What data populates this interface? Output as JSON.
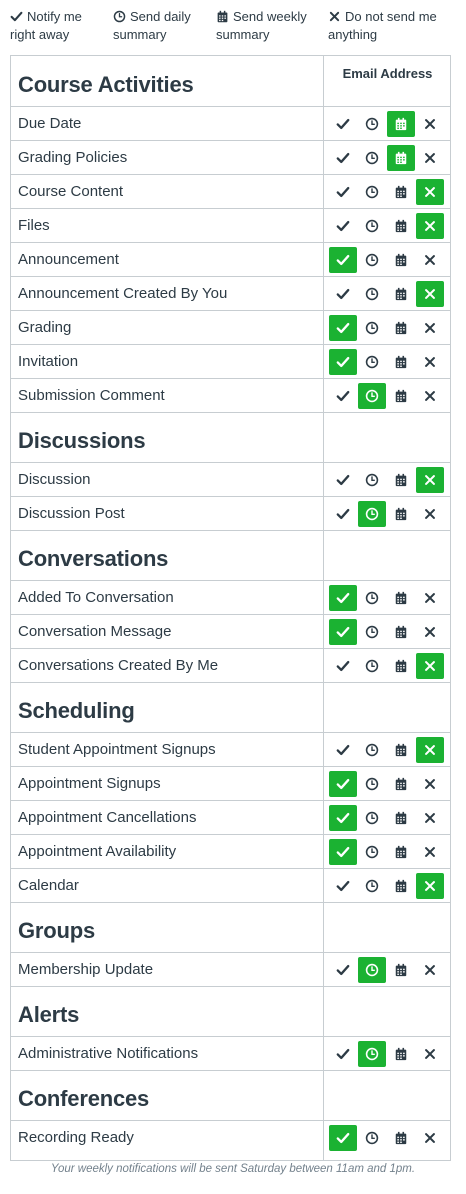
{
  "legend": [
    {
      "icon": "check-icon",
      "label": "Notify me\nright away"
    },
    {
      "icon": "clock-icon",
      "label": "Send daily\nsummary"
    },
    {
      "icon": "calendar-icon",
      "label": "Send weekly\nsummary"
    },
    {
      "icon": "x-icon",
      "label": "Do not send me\nanything"
    }
  ],
  "table": {
    "channel_header": "Email Address"
  },
  "colors": {
    "selected": "#1bb232",
    "icon": "#2d3b45",
    "border": "#c7cdd1"
  },
  "categories": [
    {
      "title": "Course Activities",
      "items": [
        {
          "label": "Due Date",
          "selected": "weekly"
        },
        {
          "label": "Grading Policies",
          "selected": "weekly"
        },
        {
          "label": "Course Content",
          "selected": "never"
        },
        {
          "label": "Files",
          "selected": "never"
        },
        {
          "label": "Announcement",
          "selected": "immediately"
        },
        {
          "label": "Announcement Created By You",
          "selected": "never"
        },
        {
          "label": "Grading",
          "selected": "immediately"
        },
        {
          "label": "Invitation",
          "selected": "immediately"
        },
        {
          "label": "Submission Comment",
          "selected": "daily"
        }
      ]
    },
    {
      "title": "Discussions",
      "items": [
        {
          "label": "Discussion",
          "selected": "never"
        },
        {
          "label": "Discussion Post",
          "selected": "daily"
        }
      ]
    },
    {
      "title": "Conversations",
      "items": [
        {
          "label": "Added To Conversation",
          "selected": "immediately"
        },
        {
          "label": "Conversation Message",
          "selected": "immediately"
        },
        {
          "label": "Conversations Created By Me",
          "selected": "never"
        }
      ]
    },
    {
      "title": "Scheduling",
      "items": [
        {
          "label": "Student Appointment Signups",
          "selected": "never"
        },
        {
          "label": "Appointment Signups",
          "selected": "immediately"
        },
        {
          "label": "Appointment Cancellations",
          "selected": "immediately"
        },
        {
          "label": "Appointment Availability",
          "selected": "immediately"
        },
        {
          "label": "Calendar",
          "selected": "never"
        }
      ]
    },
    {
      "title": "Groups",
      "items": [
        {
          "label": "Membership Update",
          "selected": "daily"
        }
      ]
    },
    {
      "title": "Alerts",
      "items": [
        {
          "label": "Administrative Notifications",
          "selected": "daily"
        }
      ]
    },
    {
      "title": "Conferences",
      "items": [
        {
          "label": "Recording Ready",
          "selected": "immediately"
        }
      ]
    }
  ],
  "footnote": "Your weekly notifications will be sent Saturday between 11am and 1pm."
}
